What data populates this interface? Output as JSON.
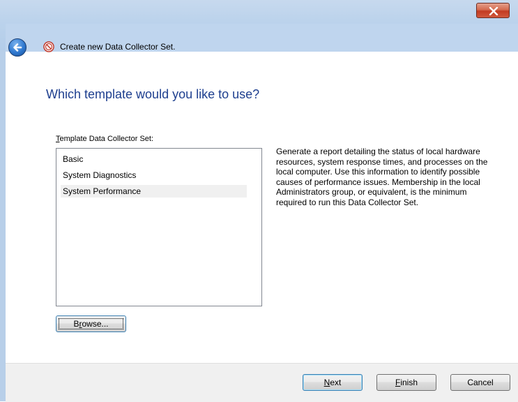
{
  "window": {
    "title": "Create new Data Collector Set."
  },
  "page": {
    "heading": "Which template would you like to use?"
  },
  "template_list": {
    "label_access_key": "T",
    "label_rest": "emplate Data Collector Set:",
    "items": [
      {
        "label": "Basic",
        "selected": false
      },
      {
        "label": "System Diagnostics",
        "selected": false
      },
      {
        "label": "System Performance",
        "selected": true
      }
    ]
  },
  "description": "Generate a report detailing the status of local hardware resources, system response times, and processes on the local computer. Use this information to identify possible causes of performance issues. Membership in the local Administrators group, or equivalent, is the minimum required to run this Data Collector Set.",
  "buttons": {
    "browse": {
      "pre": "B",
      "key": "r",
      "post": "owse..."
    },
    "next": {
      "pre": "",
      "key": "N",
      "post": "ext"
    },
    "finish": {
      "pre": "",
      "key": "F",
      "post": "inish"
    },
    "cancel": "Cancel"
  },
  "colors": {
    "heading": "#1e3f8f",
    "titlebar": "#bfd5ee",
    "close_button": "#c23b22",
    "selection": "#f0f0f0"
  },
  "icons": [
    "back-arrow-icon",
    "performance-monitor-icon",
    "close-icon"
  ]
}
